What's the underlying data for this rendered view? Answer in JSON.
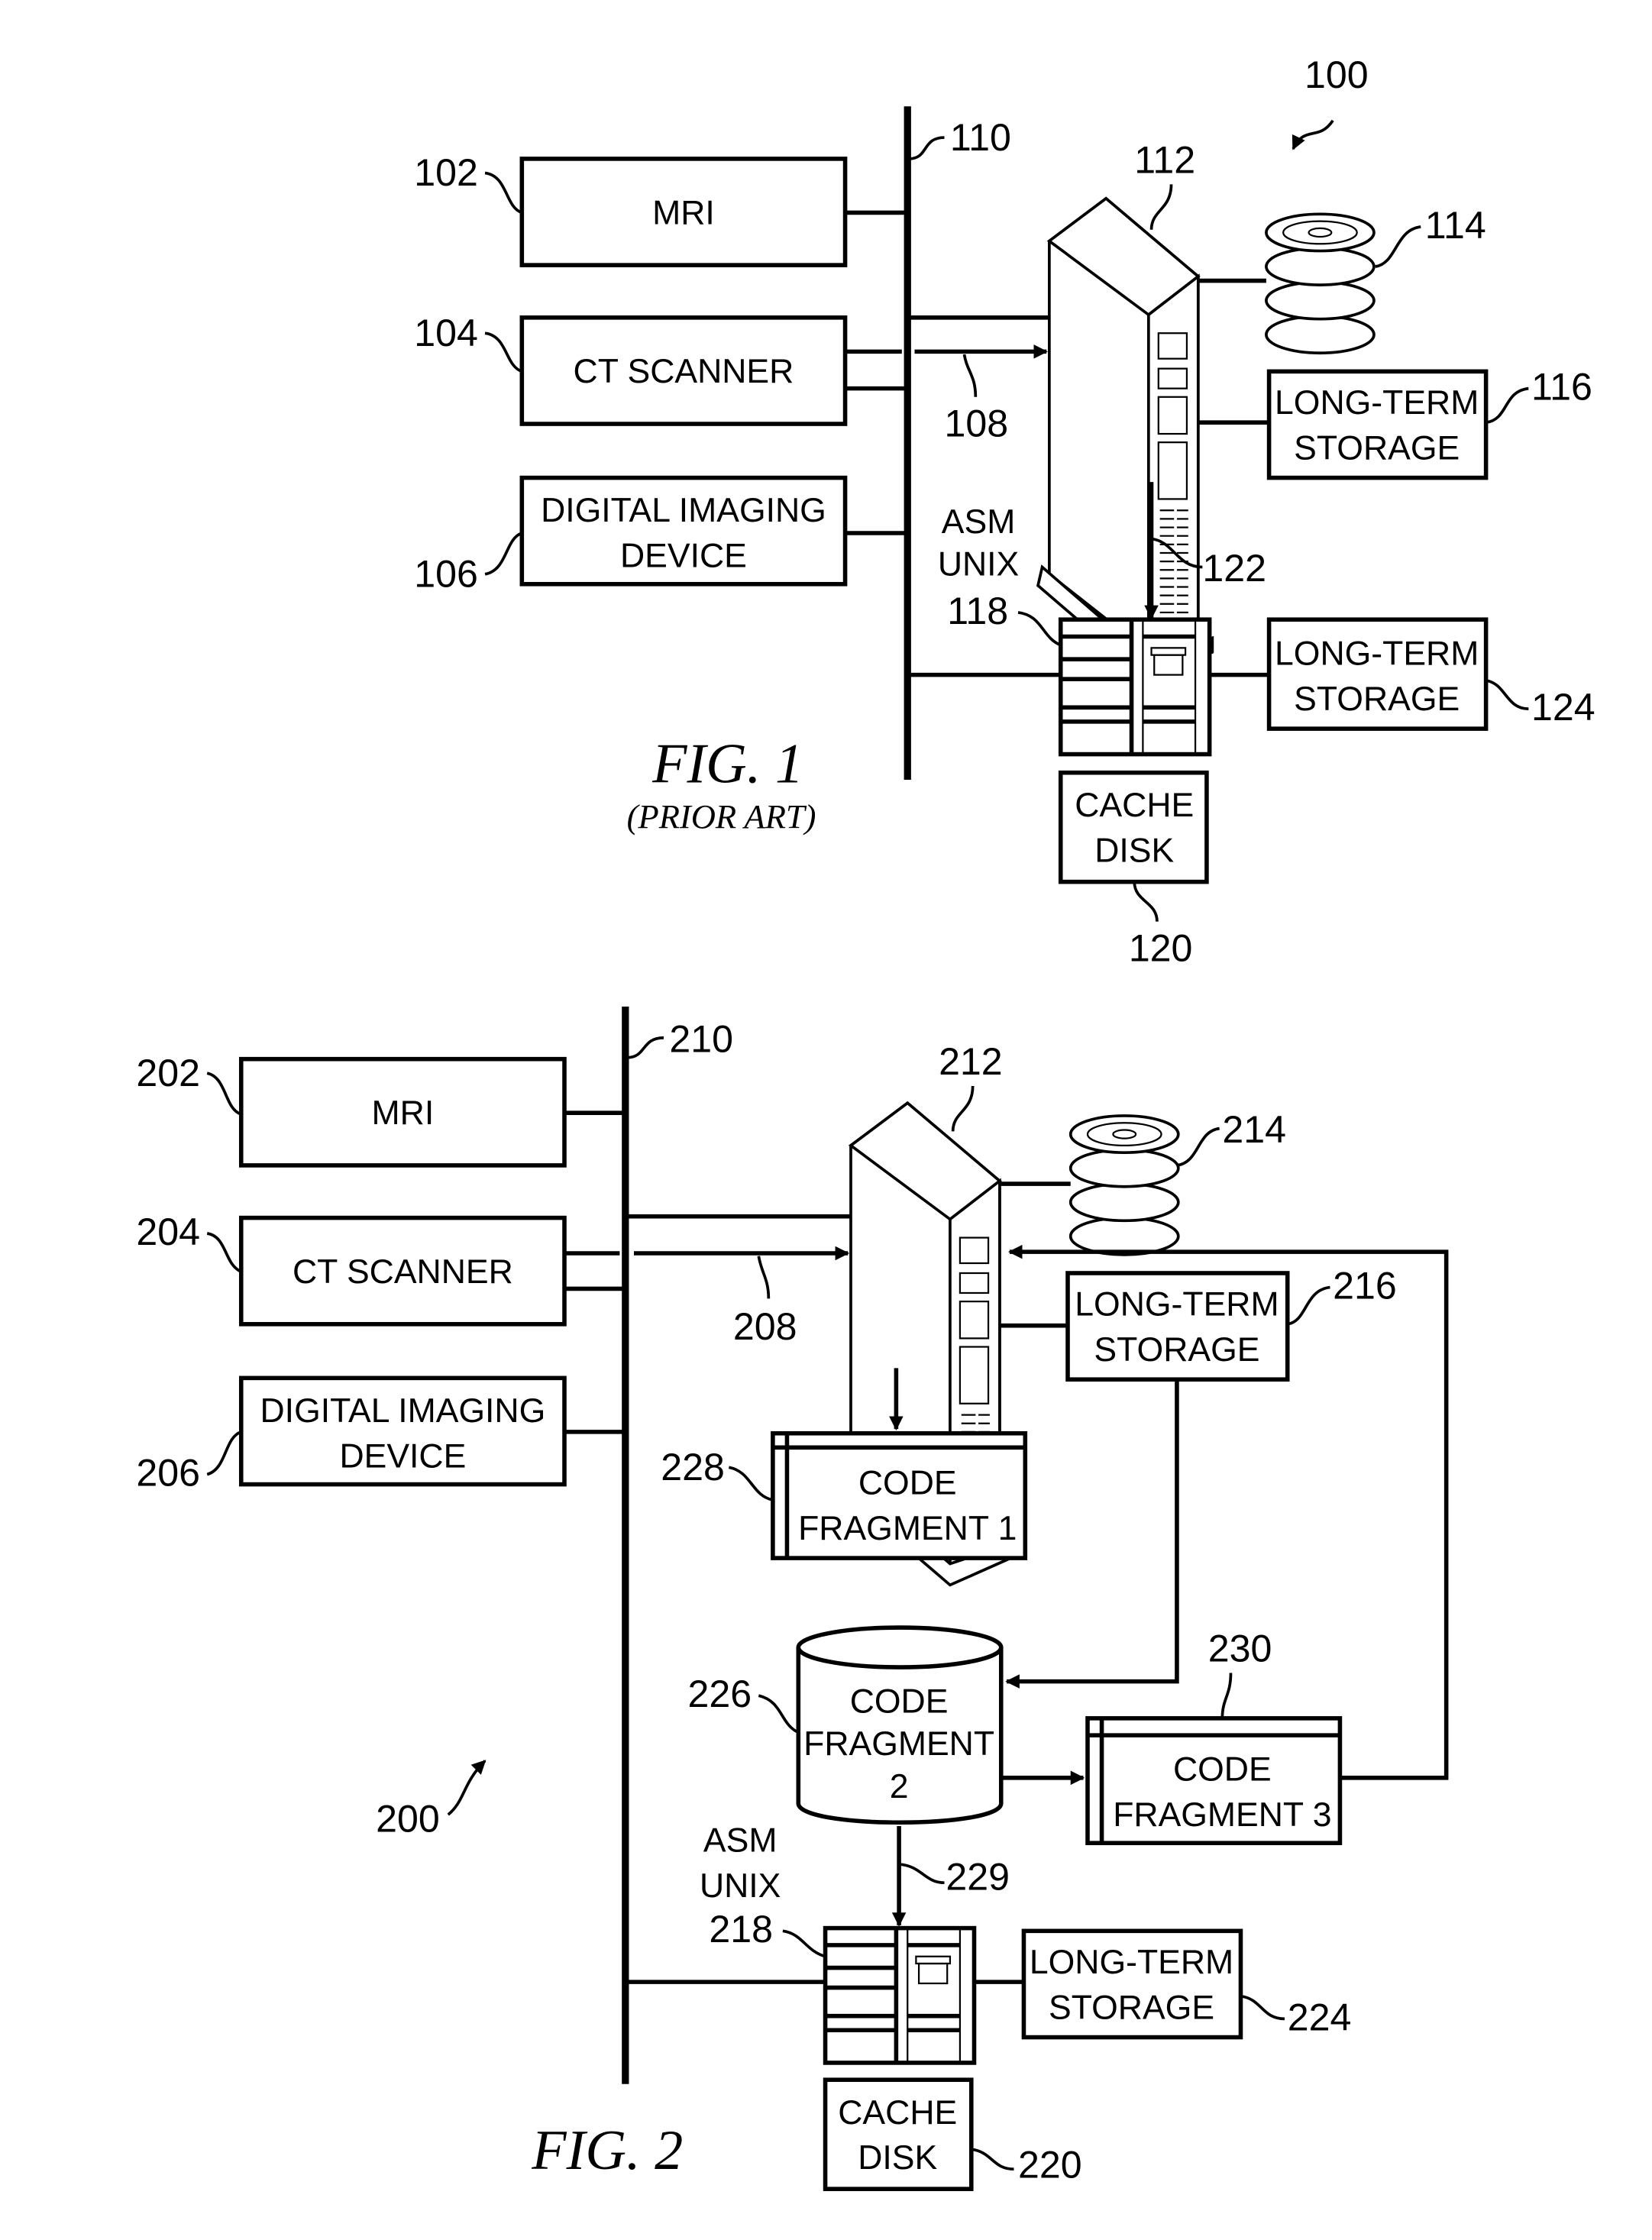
{
  "fig1": {
    "title": "FIG. 1",
    "subtitle": "(PRIOR ART)",
    "system_ref": "100",
    "bus_ref": "110",
    "mri": {
      "label": "MRI",
      "ref": "102"
    },
    "ct": {
      "label": "CT SCANNER",
      "ref": "104"
    },
    "dig": {
      "line1": "DIGITAL IMAGING",
      "line2": "DEVICE",
      "ref": "106"
    },
    "conn_ref": "108",
    "server_ref": "112",
    "tapes_ref": "114",
    "lts1": {
      "line1": "LONG-TERM",
      "line2": "STORAGE",
      "ref": "116"
    },
    "asm": {
      "line1": "ASM",
      "line2": "UNIX",
      "ref": "118"
    },
    "cache": {
      "line1": "CACHE",
      "line2": "DISK",
      "ref": "120"
    },
    "link_ref": "122",
    "lts2": {
      "line1": "LONG-TERM",
      "line2": "STORAGE",
      "ref": "124"
    }
  },
  "fig2": {
    "title": "FIG. 2",
    "system_ref": "200",
    "bus_ref": "210",
    "mri": {
      "label": "MRI",
      "ref": "202"
    },
    "ct": {
      "label": "CT SCANNER",
      "ref": "204"
    },
    "dig": {
      "line1": "DIGITAL IMAGING",
      "line2": "DEVICE",
      "ref": "206"
    },
    "conn_ref": "208",
    "server_ref": "212",
    "tapes_ref": "214",
    "lts1": {
      "line1": "LONG-TERM",
      "line2": "STORAGE",
      "ref": "216"
    },
    "asm": {
      "line1": "ASM",
      "line2": "UNIX",
      "ref": "218"
    },
    "cache": {
      "line1": "CACHE",
      "line2": "DISK",
      "ref": "220"
    },
    "lts2": {
      "line1": "LONG-TERM",
      "line2": "STORAGE",
      "ref": "224"
    },
    "frag2": {
      "line1": "CODE",
      "line2": "FRAGMENT",
      "line3": "2",
      "ref": "226"
    },
    "frag1": {
      "line1": "CODE",
      "line2": "FRAGMENT 1",
      "ref": "228"
    },
    "link_ref": "229",
    "frag3": {
      "line1": "CODE",
      "line2": "FRAGMENT 3",
      "ref": "230"
    }
  }
}
